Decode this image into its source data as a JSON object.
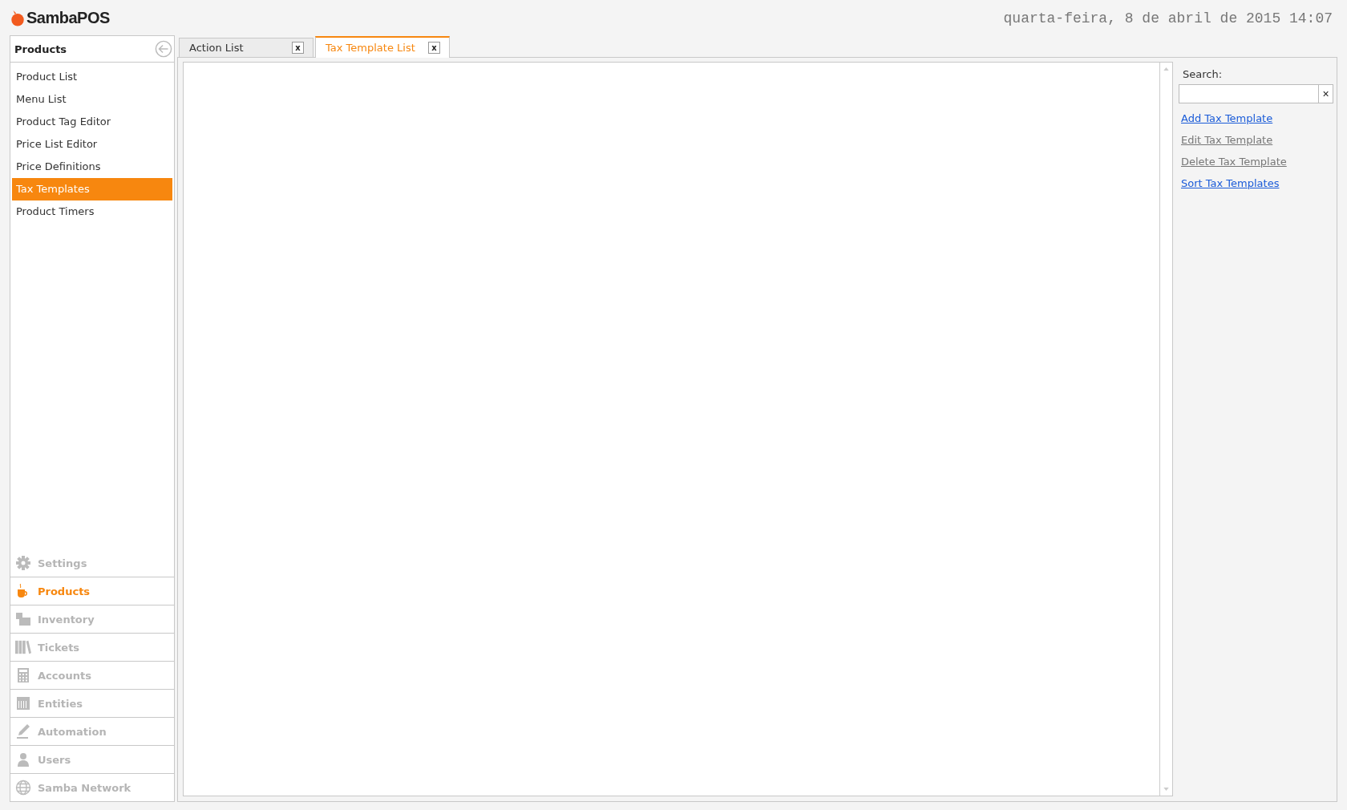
{
  "app": {
    "logo": "SambaPOS",
    "datetime": "quarta-feira, 8 de abril de 2015 14:07"
  },
  "sidebar": {
    "title": "Products",
    "items": [
      {
        "label": "Product List",
        "selected": false
      },
      {
        "label": "Menu List",
        "selected": false
      },
      {
        "label": "Product Tag Editor",
        "selected": false
      },
      {
        "label": "Price List Editor",
        "selected": false
      },
      {
        "label": "Price Definitions",
        "selected": false
      },
      {
        "label": "Tax Templates",
        "selected": true
      },
      {
        "label": "Product Timers",
        "selected": false
      }
    ],
    "nav": [
      {
        "kind": "settings",
        "label": "Settings",
        "selected": false
      },
      {
        "kind": "products",
        "label": "Products",
        "selected": true
      },
      {
        "kind": "inventory",
        "label": "Inventory",
        "selected": false
      },
      {
        "kind": "tickets",
        "label": "Tickets",
        "selected": false
      },
      {
        "kind": "accounts",
        "label": "Accounts",
        "selected": false
      },
      {
        "kind": "entities",
        "label": "Entities",
        "selected": false
      },
      {
        "kind": "automation",
        "label": "Automation",
        "selected": false
      },
      {
        "kind": "users",
        "label": "Users",
        "selected": false
      },
      {
        "kind": "network",
        "label": "Samba Network",
        "selected": false
      }
    ]
  },
  "tabs": [
    {
      "label": "Action List",
      "close": "x",
      "selected": false
    },
    {
      "label": "Tax Template List",
      "close": "x",
      "selected": true
    }
  ],
  "panel": {
    "search_label": "Search:",
    "clear": "×",
    "actions": [
      {
        "label": "Add Tax Template",
        "disabled": false
      },
      {
        "label": "Edit Tax Template",
        "disabled": true
      },
      {
        "label": "Delete Tax Template",
        "disabled": true
      },
      {
        "label": "Sort Tax Templates",
        "disabled": false
      }
    ]
  }
}
